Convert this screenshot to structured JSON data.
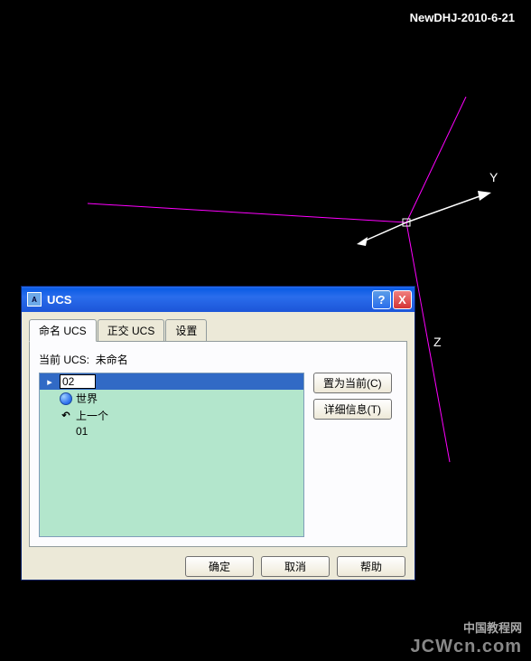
{
  "header": {
    "watermark": "NewDHJ-2010-6-21"
  },
  "axes": {
    "y_label": "Y",
    "z_label": "Z"
  },
  "dialog": {
    "title": "UCS",
    "help_btn": "?",
    "close_btn": "X",
    "tabs": {
      "named": "命名 UCS",
      "ortho": "正交 UCS",
      "settings": "设置"
    },
    "current_label": "当前 UCS:",
    "current_value": "未命名",
    "list": {
      "item_edit": "02",
      "item_world": "世界",
      "item_prev": "上一个",
      "item_01": "01"
    },
    "side_buttons": {
      "set_current": "置为当前(C)",
      "details": "详细信息(T)"
    },
    "bottom_buttons": {
      "ok": "确定",
      "cancel": "取消",
      "help": "帮助"
    }
  },
  "footer": {
    "line1": "中国教程网",
    "line2": "JCWcn.com"
  }
}
